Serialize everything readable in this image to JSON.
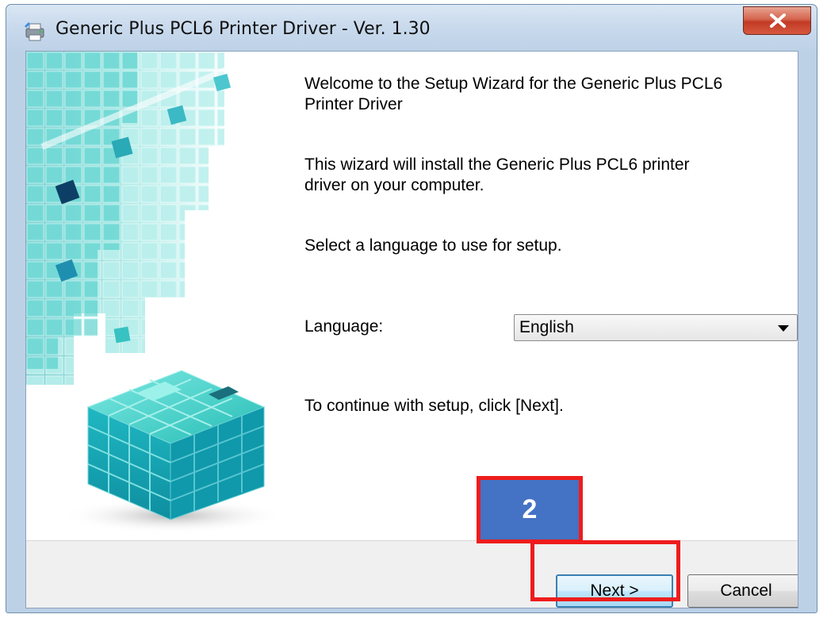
{
  "window": {
    "title": "Generic Plus PCL6 Printer Driver - Ver. 1.30",
    "icon": "printer-setup-icon",
    "close_icon": "close-x-icon"
  },
  "content": {
    "welcome": "Welcome to the Setup Wizard for the Generic Plus PCL6 Printer Driver",
    "info": "This wizard will install the Generic Plus PCL6 printer driver on your computer.",
    "select_language": "Select a language to use for setup.",
    "language_label": "Language:",
    "language_value": "English",
    "continue": "To continue with setup, click [Next]."
  },
  "buttons": {
    "next": "Next >",
    "cancel": "Cancel"
  },
  "annotation": {
    "step_number": "2",
    "badge_fill": "#4472c4",
    "highlight_color": "#ee1c1c"
  }
}
